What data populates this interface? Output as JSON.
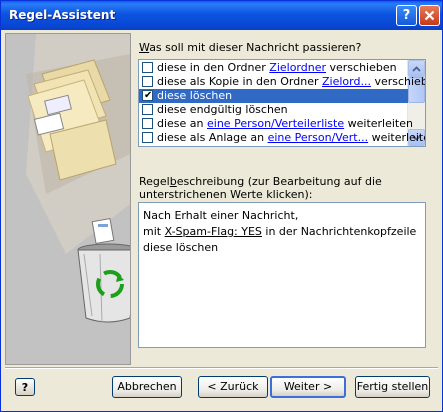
{
  "window": {
    "title": "Regel-Assistent"
  },
  "question": {
    "label": "Was soll mit dieser Nachricht passieren?"
  },
  "actions": [
    {
      "checked": false,
      "selected": false,
      "pre": "diese in den Ordner ",
      "link": "Zielordner",
      "post": " verschieben"
    },
    {
      "checked": false,
      "selected": false,
      "pre": "diese als Kopie in den Ordner ",
      "link": "Zielord...",
      "post": " verschieben"
    },
    {
      "checked": true,
      "selected": true,
      "pre": "diese löschen",
      "link": "",
      "post": ""
    },
    {
      "checked": false,
      "selected": false,
      "pre": "diese endgültig löschen",
      "link": "",
      "post": ""
    },
    {
      "checked": false,
      "selected": false,
      "pre": "diese an ",
      "link": "eine Person/Verteilerliste",
      "post": " weiterleiten"
    },
    {
      "checked": false,
      "selected": false,
      "pre": "diese als Anlage an ",
      "link": "eine Person/Vert...",
      "post": " weiterleiten"
    }
  ],
  "description": {
    "label": "Regelbeschreibung (zur Bearbeitung auf die unterstrichenen Werte klicken):",
    "line1": "Nach Erhalt einer Nachricht,",
    "line2_pre": "mit ",
    "line2_link": "X-Spam-Flag: YES",
    "line2_post": " in der Nachrichtenkopfzeile",
    "line3": "diese löschen"
  },
  "buttons": {
    "help": "?",
    "cancel": "Abbrechen",
    "back": "< Zurück",
    "next": "Weiter >",
    "finish": "Fertig stellen"
  }
}
